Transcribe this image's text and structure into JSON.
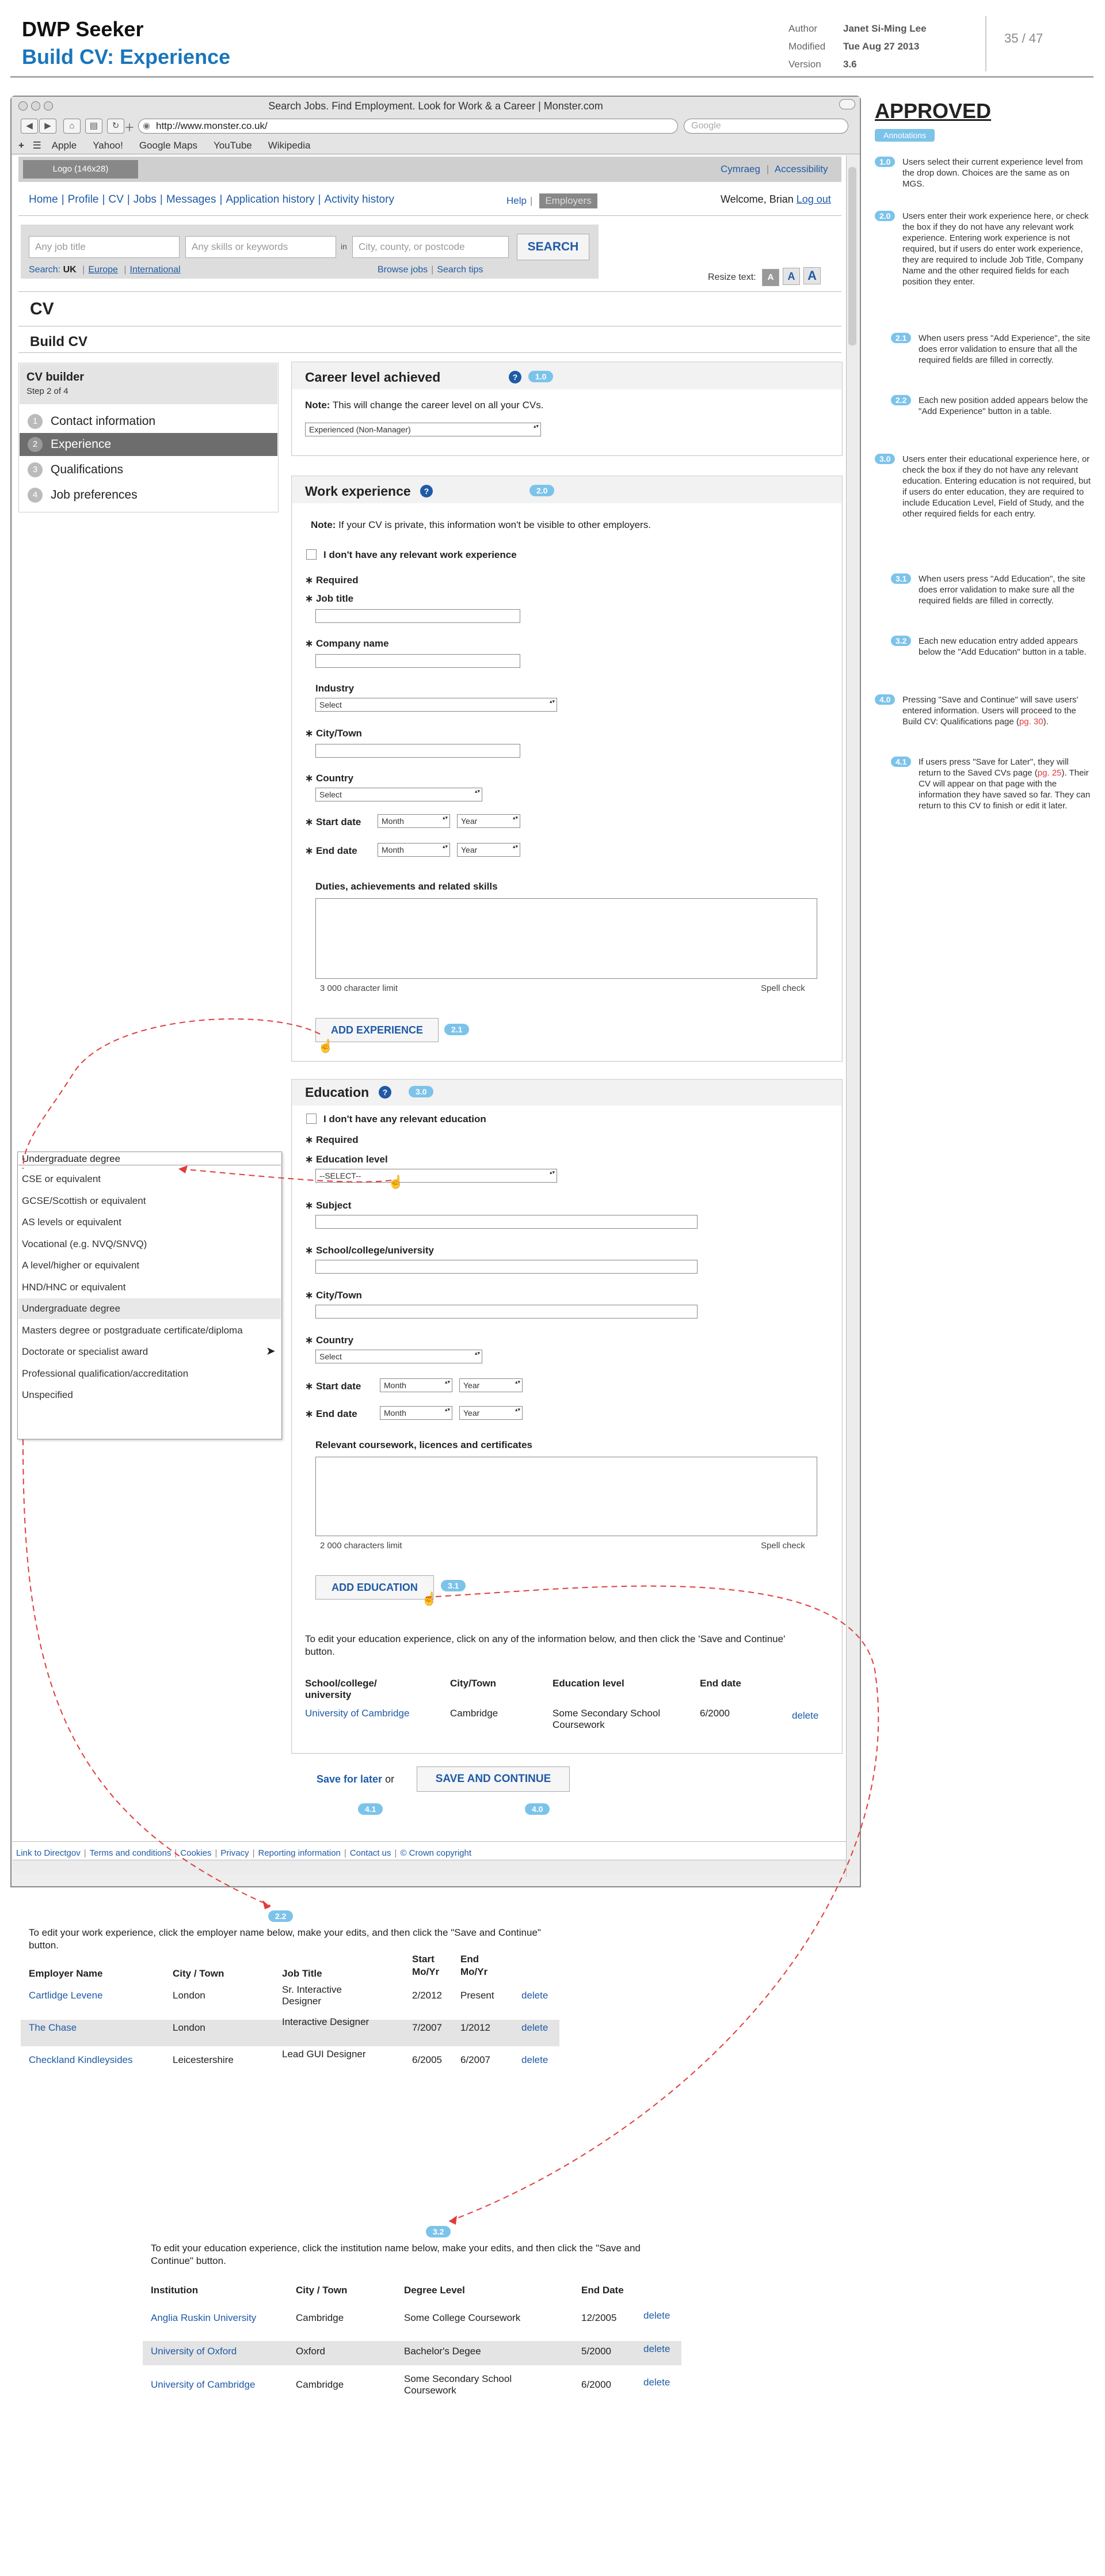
{
  "doc": {
    "title": "DWP Seeker",
    "subtitle": "Build CV: Experience",
    "author_label": "Author",
    "author": "Janet Si-Ming Lee",
    "modified_label": "Modified",
    "modified": "Tue Aug 27 2013",
    "version_label": "Version",
    "version": "3.6",
    "page": "35 / 47"
  },
  "browser": {
    "title": "Search Jobs. Find Employment. Look for Work & a Career | Monster.com",
    "url": "http://www.monster.co.uk/",
    "search_placeholder": "Google",
    "bookmarks": [
      "Apple",
      "Yahoo!",
      "Google Maps",
      "YouTube",
      "Wikipedia"
    ]
  },
  "site": {
    "logo": "Logo (146x28)",
    "cymraeg": "Cymraeg",
    "accessibility": "Accessibility",
    "nav": [
      "Home",
      "Profile",
      "CV",
      "Jobs",
      "Messages",
      "Application history",
      "Activity history"
    ],
    "help": "Help",
    "employers": "Employers",
    "welcome": "Welcome, Brian",
    "logout": "Log out",
    "search": {
      "job_placeholder": "Any job title",
      "skills_placeholder": "Any skills or keywords",
      "in_label": "in",
      "city_placeholder": "City, county, or postcode",
      "button": "SEARCH",
      "search_label": "Search:",
      "uk": "UK",
      "europe": "Europe",
      "international": "International",
      "browse_jobs": "Browse jobs",
      "search_tips": "Search tips"
    },
    "resize_label": "Resize text:",
    "resize_options": [
      "A",
      "A",
      "A"
    ],
    "page_title": "CV",
    "page_subtitle": "Build CV",
    "footer": [
      "Link to Directgov",
      "Terms and conditions",
      "Cookies",
      "Privacy",
      "Reporting information",
      "Contact us",
      "© Crown copyright"
    ]
  },
  "sidenav": {
    "title": "CV builder",
    "step": "Step 2 of 4",
    "items": [
      {
        "num": "1",
        "label": "Contact information"
      },
      {
        "num": "2",
        "label": "Experience"
      },
      {
        "num": "3",
        "label": "Qualifications"
      },
      {
        "num": "4",
        "label": "Job preferences"
      }
    ]
  },
  "career": {
    "title": "Career level achieved",
    "tag": "1.0",
    "note_bold": "Note:",
    "note": " This will change the career level on all your CVs.",
    "value": "Experienced (Non-Manager)"
  },
  "work": {
    "title": "Work experience",
    "tag": "2.0",
    "note_bold": "Note:",
    "note": " If your CV is private, this information won't be visible to other employers.",
    "no_exp": "I don't have any relevant work experience",
    "required": "Required",
    "job_title": "Job title",
    "company": "Company name",
    "industry": "Industry",
    "industry_value": "Select",
    "city": "City/Town",
    "country": "Country",
    "country_value": "Select",
    "start": "Start date",
    "end": "End date",
    "month": "Month",
    "year": "Year",
    "duties": "Duties, achievements and related skills",
    "limit": "3 000 character limit",
    "spell": "Spell check",
    "add_button": "ADD EXPERIENCE",
    "add_tag": "2.1"
  },
  "education": {
    "title": "Education",
    "tag": "3.0",
    "no_edu": "I don't have any relevant education",
    "required": "Required",
    "level": "Education level",
    "level_value": "--SELECT--",
    "subject": "Subject",
    "school": "School/college/university",
    "city": "City/Town",
    "country": "Country",
    "country_value": "Select",
    "start": "Start date",
    "end": "End date",
    "month": "Month",
    "year": "Year",
    "coursework": "Relevant coursework, licences and certificates",
    "limit": "2 000 characters limit",
    "spell": "Spell check",
    "add_button": "ADD EDUCATION",
    "add_tag": "3.1",
    "edit_text": "To edit your education experience, click on any of the information below, and then click the 'Save and Continue' button.",
    "headers": [
      "School/college/ university",
      "City/Town",
      "Education level",
      "End date"
    ],
    "row": {
      "school": "University of Cambridge",
      "city": "Cambridge",
      "level": "Some Secondary School Coursework",
      "end": "6/2000",
      "action": "delete"
    }
  },
  "actions": {
    "save_later": "Save for later",
    "or": "or",
    "save_continue": "SAVE AND CONTINUE",
    "tag_later": "4.1",
    "tag_continue": "4.0"
  },
  "dropdown": {
    "selected": "Undergraduate degree",
    "options": [
      "CSE or equivalent",
      "GCSE/Scottish or equivalent",
      "AS levels or equivalent",
      "Vocational (e.g. NVQ/SNVQ)",
      "A level/higher or equivalent",
      "HND/HNC or equivalent",
      "Undergraduate degree",
      "Masters degree or postgraduate certificate/diploma",
      "Doctorate or specialist award",
      "Professional qualification/accreditation",
      "Unspecified"
    ]
  },
  "annotations": {
    "approved": "APPROVED",
    "tab": "Annotations",
    "items": [
      {
        "tag": "1.0",
        "text": "Users select their current experience level from the drop down. Choices are the same as on MGS."
      },
      {
        "tag": "2.0",
        "text": "Users enter their work experience here, or check the box if they do not have any relevant work experience. Entering work experience is not required, but if users do enter work experience, they are required to include Job Title, Company Name and the other required fields for each position they enter."
      },
      {
        "tag": "2.1",
        "text": "When users press \"Add Experience\", the site does error validation to ensure that all the required fields are filled in correctly."
      },
      {
        "tag": "2.2",
        "text": "Each new position added appears below the \"Add Experience\" button in a table."
      },
      {
        "tag": "3.0",
        "text": "Users enter their educational experience here, or check the box if they do not have any relevant education. Entering education is not required, but if users do enter education, they are required to include Education Level, Field of Study, and the other required fields for each entry."
      },
      {
        "tag": "3.1",
        "text": "When users press \"Add Education\", the site does error validation to make sure all the required fields are filled in correctly."
      },
      {
        "tag": "3.2",
        "text": "Each new education entry added appears below the \"Add Education\" button in a table."
      },
      {
        "tag": "4.0",
        "text_a": "Pressing \"Save and Continue\" will save users' entered information. Users will proceed to the Build CV: Qualifications page (",
        "link": "pg. 30",
        "text_b": ")."
      },
      {
        "tag": "4.1",
        "text_a": "If users press \"Save for Later\", they will return to the Saved CVs page (",
        "link": "pg. 25",
        "text_b": "). Their CV will appear on that page with the information they have saved so far. They can return to this CV to finish or edit it later."
      }
    ]
  },
  "work_table": {
    "tag": "2.2",
    "intro": "To edit your work experience, click the employer name below, make your edits, and then click the \"Save and Continue\" button.",
    "headers": [
      "Employer Name",
      "City / Town",
      "Job Title",
      "Start Mo/Yr",
      "End Mo/Yr",
      ""
    ],
    "rows": [
      {
        "employer": "Cartlidge Levene",
        "city": "London",
        "title": "Sr. Interactive Designer",
        "start": "2/2012",
        "end": "Present",
        "action": "delete"
      },
      {
        "employer": "The Chase",
        "city": "London",
        "title": "Interactive Designer",
        "start": "7/2007",
        "end": "1/2012",
        "action": "delete"
      },
      {
        "employer": "Checkland Kindleysides",
        "city": "Leicestershire",
        "title": "Lead GUI Designer",
        "start": "6/2005",
        "end": "6/2007",
        "action": "delete"
      }
    ]
  },
  "edu_table": {
    "tag": "3.2",
    "intro": "To edit your education experience, click the institution name below, make your edits, and then click the \"Save and Continue\" button.",
    "headers": [
      "Institution",
      "City / Town",
      "Degree Level",
      "End Date",
      ""
    ],
    "rows": [
      {
        "inst": "Anglia Ruskin University",
        "city": "Cambridge",
        "level": "Some College Coursework",
        "end": "12/2005",
        "action": "delete"
      },
      {
        "inst": "University of Oxford",
        "city": "Oxford",
        "level": "Bachelor's Degee",
        "end": "5/2000",
        "action": "delete"
      },
      {
        "inst": "University of Cambridge",
        "city": "Cambridge",
        "level": "Some Secondary School Coursework",
        "end": "6/2000",
        "action": "delete"
      }
    ]
  }
}
